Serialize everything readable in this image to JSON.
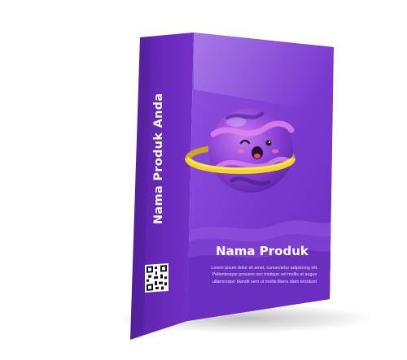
{
  "box": {
    "spine_title": "Nama Produk Anda",
    "product_name": "Nama Produk",
    "description_lines": [
      "Lorem ipsum dolor sit amet, consectetur adipiscing elit,",
      "Pellentesque posuere nec tristique vel mollis at augue",
      "ullamcorper blandit sem ut mollis libero diam tincidunt"
    ],
    "colors": {
      "front": "#7a3fd0",
      "spine": "#6a2fbf",
      "top": "#9a6ae0",
      "ring": "#f2d21e",
      "planet": "#8a4dd6"
    },
    "icons": [
      "planet-mascot-icon",
      "qr-code-icon"
    ]
  }
}
